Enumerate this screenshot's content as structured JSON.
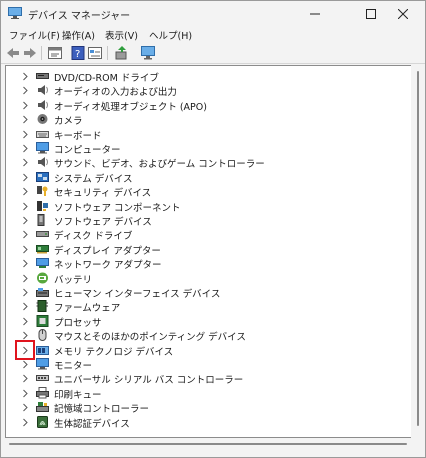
{
  "window": {
    "title": "デバイス マネージャー"
  },
  "menu": [
    {
      "label": "ファイル(F)"
    },
    {
      "label": "操作(A)"
    },
    {
      "label": "表示(V)"
    },
    {
      "label": "ヘルプ(H)"
    }
  ],
  "toolbar_icons": [
    "back-icon",
    "forward-icon",
    "properties-icon",
    "help-icon",
    "view-icon",
    "update-driver-icon",
    "scan-hardware-icon"
  ],
  "tree": [
    {
      "label": "DVD/CD-ROM ドライブ",
      "icon": "dvd-drive-icon"
    },
    {
      "label": "オーディオの入力および出力",
      "icon": "speaker-icon"
    },
    {
      "label": "オーディオ処理オブジェクト (APO)",
      "icon": "speaker-icon"
    },
    {
      "label": "カメラ",
      "icon": "camera-icon"
    },
    {
      "label": "キーボード",
      "icon": "keyboard-icon"
    },
    {
      "label": "コンピューター",
      "icon": "computer-icon"
    },
    {
      "label": "サウンド、ビデオ、およびゲーム コントローラー",
      "icon": "speaker-icon"
    },
    {
      "label": "システム デバイス",
      "icon": "system-device-icon"
    },
    {
      "label": "セキュリティ デバイス",
      "icon": "security-device-icon"
    },
    {
      "label": "ソフトウェア コンポーネント",
      "icon": "software-component-icon"
    },
    {
      "label": "ソフトウェア デバイス",
      "icon": "software-device-icon"
    },
    {
      "label": "ディスク ドライブ",
      "icon": "disk-drive-icon"
    },
    {
      "label": "ディスプレイ アダプター",
      "icon": "display-adapter-icon"
    },
    {
      "label": "ネットワーク アダプター",
      "icon": "network-adapter-icon"
    },
    {
      "label": "バッテリ",
      "icon": "battery-icon"
    },
    {
      "label": "ヒューマン インターフェイス デバイス",
      "icon": "hid-icon"
    },
    {
      "label": "ファームウェア",
      "icon": "firmware-icon"
    },
    {
      "label": "プロセッサ",
      "icon": "processor-icon"
    },
    {
      "label": "マウスとそのほかのポインティング デバイス",
      "icon": "mouse-icon"
    },
    {
      "label": "メモリ テクノロジ デバイス",
      "icon": "memory-technology-icon"
    },
    {
      "label": "モニター",
      "icon": "monitor-icon"
    },
    {
      "label": "ユニバーサル シリアル バス コントローラー",
      "icon": "usb-icon"
    },
    {
      "label": "印刷キュー",
      "icon": "printer-icon"
    },
    {
      "label": "記憶域コントローラー",
      "icon": "storage-controller-icon"
    },
    {
      "label": "生体認証デバイス",
      "icon": "biometric-icon"
    }
  ],
  "highlight_color": "#e0141e"
}
